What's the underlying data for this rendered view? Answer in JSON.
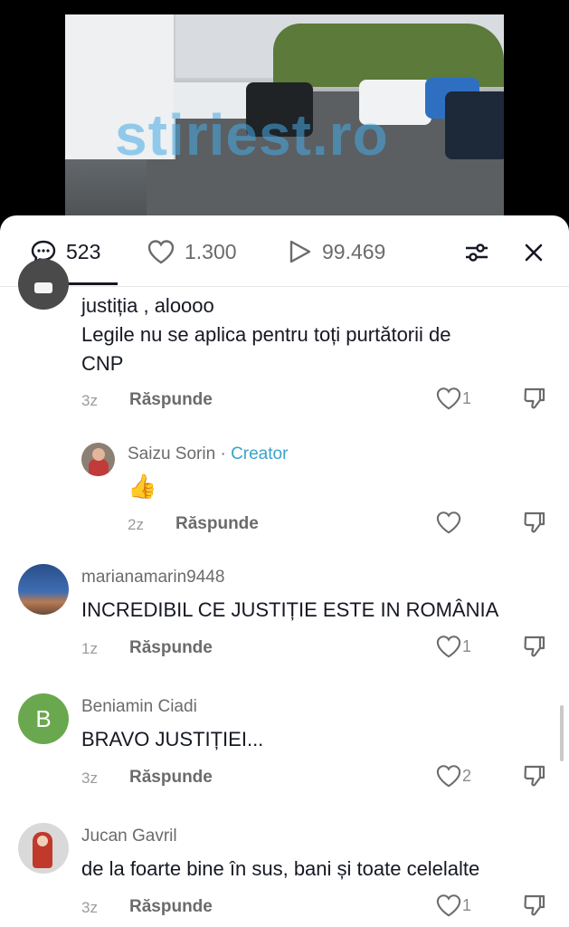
{
  "video": {
    "watermark": "stiriest.ro"
  },
  "tabs": {
    "comments_count": "523",
    "likes_count": "1.300",
    "views_count": "99.469"
  },
  "comments": [
    {
      "username": "",
      "text_line1": "justiția , aloooo",
      "text_line2": "Legile nu se aplica pentru toți purtătorii de",
      "text_line3": "CNP",
      "time": "3z",
      "reply": "Răspunde",
      "likes": "1"
    },
    {
      "username": "Saizu Sorin",
      "separator": " · ",
      "creator": "Creator",
      "text": "👍",
      "time": "2z",
      "reply": "Răspunde",
      "likes": ""
    },
    {
      "username": "marianamarin9448",
      "text": "INCREDIBIL CE JUSTIȚIE ESTE IN ROMÂNIA",
      "time": "1z",
      "reply": "Răspunde",
      "likes": "1"
    },
    {
      "username": "Beniamin Ciadi",
      "avatar_letter": "B",
      "text": "BRAVO JUSTIȚIEI...",
      "time": "3z",
      "reply": "Răspunde",
      "likes": "2"
    },
    {
      "username": "Jucan Gavril",
      "text": "de la foarte bine în sus, bani și toate celelalte",
      "time": "3z",
      "reply": "Răspunde",
      "likes": "1"
    }
  ],
  "colors": {
    "accent_creator": "#3aa3c9",
    "avatar_green": "#6aa84f",
    "text_primary": "#161823",
    "text_secondary": "#6b6b6b"
  }
}
